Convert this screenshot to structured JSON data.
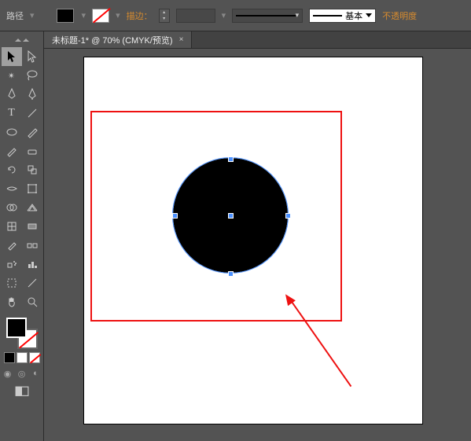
{
  "option_bar": {
    "mode_label": "路径",
    "fill_color": "#000000",
    "stroke_color": "none",
    "stroke_label": "描边：",
    "stroke_weight": "",
    "stroke_style_label": "基本",
    "opacity_label": "不透明度"
  },
  "document": {
    "tab_title": "未标题-1* @ 70% (CMYK/预览)",
    "tab_close": "×"
  },
  "tools": [
    {
      "name": "selection-tool",
      "icon": "▲"
    },
    {
      "name": "direct-selection-tool",
      "icon": "△"
    },
    {
      "name": "magic-wand-tool",
      "icon": "✴"
    },
    {
      "name": "lasso-tool",
      "icon": "◉"
    },
    {
      "name": "pen-tool",
      "icon": "✒"
    },
    {
      "name": "curvature-tool",
      "icon": "✎"
    },
    {
      "name": "type-tool",
      "icon": "T"
    },
    {
      "name": "line-tool",
      "icon": "╱"
    },
    {
      "name": "ellipse-tool",
      "icon": "◯"
    },
    {
      "name": "paintbrush-tool",
      "icon": "／"
    },
    {
      "name": "pencil-tool",
      "icon": "✎"
    },
    {
      "name": "eraser-tool",
      "icon": "◧"
    },
    {
      "name": "rotate-tool",
      "icon": "⟳"
    },
    {
      "name": "scale-tool",
      "icon": "⤢"
    },
    {
      "name": "width-tool",
      "icon": "≋"
    },
    {
      "name": "free-transform-tool",
      "icon": "▭"
    },
    {
      "name": "shape-builder-tool",
      "icon": "◫"
    },
    {
      "name": "perspective-grid-tool",
      "icon": "▦"
    },
    {
      "name": "mesh-tool",
      "icon": "▤"
    },
    {
      "name": "gradient-tool",
      "icon": "▮"
    },
    {
      "name": "eyedropper-tool",
      "icon": "✐"
    },
    {
      "name": "blend-tool",
      "icon": "◑"
    },
    {
      "name": "symbol-sprayer-tool",
      "icon": "❋"
    },
    {
      "name": "column-graph-tool",
      "icon": "▮"
    },
    {
      "name": "artboard-tool",
      "icon": "▢"
    },
    {
      "name": "slice-tool",
      "icon": "✂"
    },
    {
      "name": "hand-tool",
      "icon": "✋"
    },
    {
      "name": "zoom-tool",
      "icon": "🔍"
    }
  ],
  "canvas": {
    "circle_fill": "#000000",
    "selection_color": "#4a90ff",
    "annotation_color": "#e11"
  }
}
